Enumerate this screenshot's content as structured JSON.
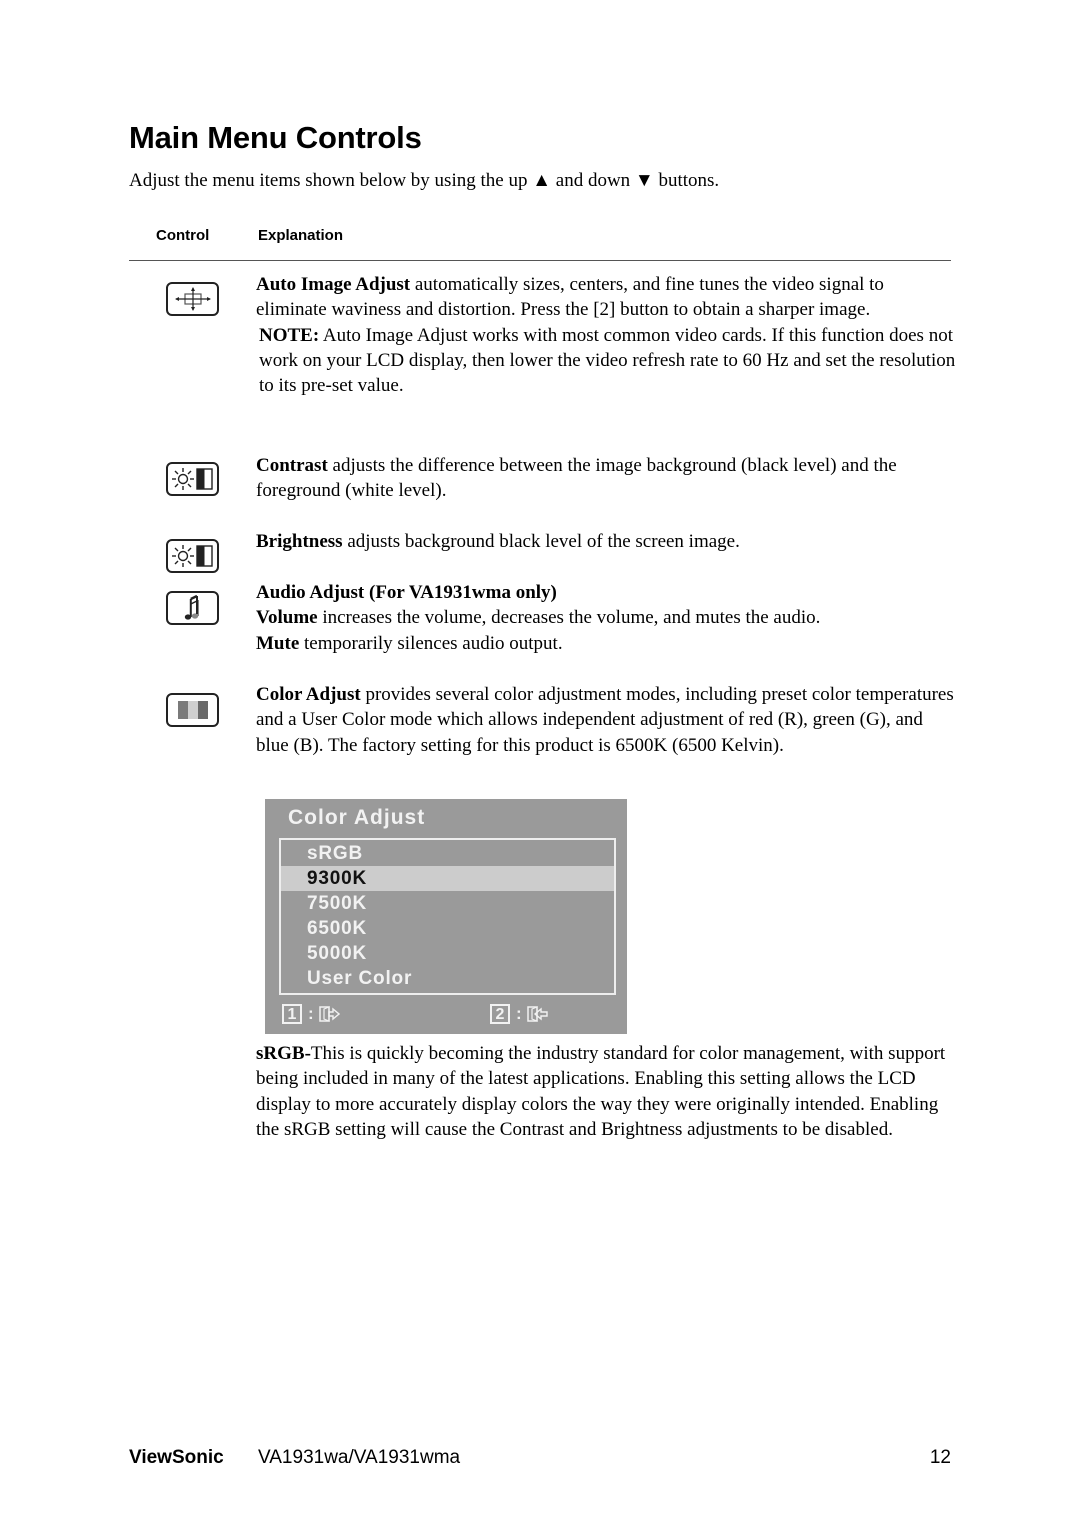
{
  "page": {
    "title": "Main Menu Controls",
    "intro": {
      "before": "Adjust the menu items shown below by using the up ",
      "up_glyph": "▲",
      "middle": " and down ",
      "down_glyph": "▼",
      "after": " buttons."
    },
    "table_headers": {
      "control": "Control",
      "explanation": "Explanation"
    }
  },
  "controls": [
    {
      "icon": "auto-image-adjust-icon",
      "paragraphs": [
        {
          "bold": "Auto Image Adjust",
          "text": " automatically sizes, centers, and fine tunes the video signal to eliminate waviness and distortion. Press the [2] button to obtain a sharper image."
        },
        {
          "bold": "NOTE:",
          "text": " Auto Image Adjust works with most common video cards. If this function does not work on your LCD display, then lower the video refresh rate to 60 Hz and set the resolution to its pre-set value."
        }
      ]
    },
    {
      "icon": "contrast-icon",
      "paragraphs": [
        {
          "bold": "Contrast",
          "text": " adjusts the difference between the image background  (black level) and the foreground (white level)."
        }
      ]
    },
    {
      "icon": "brightness-icon",
      "paragraphs": [
        {
          "bold": "Brightness",
          "text": " adjusts background black level of the screen image."
        }
      ]
    },
    {
      "icon": "audio-adjust-icon",
      "heading": "Audio Adjust (For VA1931wma only)",
      "paragraphs": [
        {
          "bold": "Volume",
          "text": " increases the volume, decreases the volume, and mutes the audio."
        },
        {
          "bold": "Mute",
          "text": " temporarily silences audio output."
        }
      ]
    },
    {
      "icon": "color-adjust-icon",
      "paragraphs": [
        {
          "bold": "Color Adjust",
          "text": " provides several color adjustment modes, including preset color temperatures and a User Color mode which allows independent adjustment of red (R), green (G), and blue (B). The factory setting for this product is 6500K (6500 Kelvin)."
        }
      ]
    }
  ],
  "osd_menu": {
    "title": "Color Adjust",
    "items": [
      "sRGB",
      "9300K",
      "7500K",
      "6500K",
      "5000K",
      "User Color"
    ],
    "selected_index": 1,
    "footer": [
      {
        "key": "1",
        "separator": ":",
        "icon": "exit-icon"
      },
      {
        "key": "2",
        "separator": ":",
        "icon": "enter-icon"
      }
    ],
    "colors": {
      "panel": "#9a9a9a",
      "highlight": "#cccccc",
      "text": "#f2f2f2"
    }
  },
  "srgb_note": {
    "bold": "sRGB-",
    "text": "This is quickly becoming the industry standard for color management, with support being included in many of the latest applications. Enabling this setting allows the LCD display to more accurately display colors the way they were originally intended. Enabling the sRGB setting will cause the Contrast and Brightness adjustments to be disabled."
  },
  "footer": {
    "brand": "ViewSonic",
    "model": "VA1931wa/VA1931wma",
    "page_number": "12"
  }
}
